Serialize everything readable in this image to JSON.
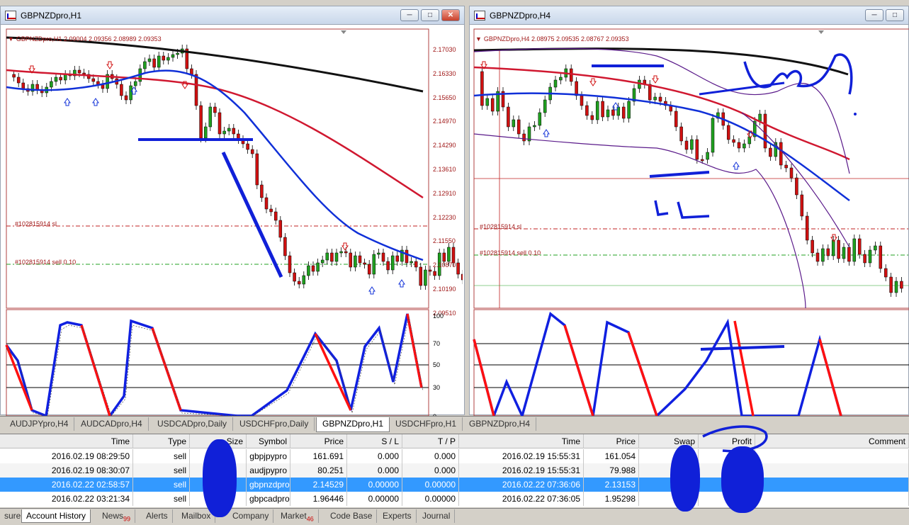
{
  "left_window": {
    "title": "GBPNZDpro,H1",
    "ohlc": "GBPNZDpro,H1  2.09004 2.09356 2.08989 2.09353",
    "sl_label": "#102815914 sl",
    "order_label": "#102815914 sell 0.10",
    "price_axis": [
      "2.17030",
      "2.16330",
      "2.15650",
      "2.14970",
      "2.14290",
      "2.13610",
      "2.12910",
      "2.12230",
      "2.11550",
      "2.10870",
      "2.10190",
      "2.09510"
    ],
    "osc_axis": [
      "100",
      "70",
      "50",
      "30",
      "0"
    ]
  },
  "right_window": {
    "title": "GBPNZDpro,H4",
    "ohlc": "GBPNZDpro,H4  2.08975 2.09535 2.08767 2.09353",
    "sl_label": "#102815914 sl",
    "order_label": "#102815914 sell 0.10"
  },
  "window_buttons": {
    "minimize": "─",
    "maximize": "□",
    "close": "✕"
  },
  "chart_tabs": [
    "AUDJPYpro,H4",
    "AUDCADpro,H4",
    "USDCADpro,Daily",
    "USDCHFpro,Daily",
    "GBPNZDpro,H1",
    "USDCHFpro,H1",
    "GBPNZDpro,H4"
  ],
  "active_chart_tab": "GBPNZDpro,H1",
  "table": {
    "headers": [
      "Time",
      "Type",
      "Size",
      "Symbol",
      "Price",
      "S / L",
      "T / P",
      "Time",
      "Price",
      "Swap",
      "Profit",
      "Comment"
    ],
    "rows": [
      [
        "2016.02.19 08:29:50",
        "sell",
        "",
        "gbpjpypro",
        "161.691",
        "0.000",
        "0.000",
        "2016.02.19 15:55:31",
        "161.054",
        "",
        ""
      ],
      [
        "2016.02.19 08:30:07",
        "sell",
        "",
        "audjpypro",
        "80.251",
        "0.000",
        "0.000",
        "2016.02.19 15:55:31",
        "79.988",
        "",
        ""
      ],
      [
        "2016.02.22 02:58:57",
        "sell",
        "",
        "gbpnzdpro",
        "2.14529",
        "0.00000",
        "0.00000",
        "2016.02.22 07:36:06",
        "2.13153",
        "",
        ""
      ],
      [
        "2016.02.22 03:21:34",
        "sell",
        "",
        "gbpcadpro",
        "1.96446",
        "0.00000",
        "0.00000",
        "2016.02.22 07:36:05",
        "1.95298",
        "",
        ""
      ]
    ]
  },
  "bottom_tabs": [
    {
      "label": "sure",
      "badge": ""
    },
    {
      "label": "Account History",
      "badge": ""
    },
    {
      "label": "News",
      "badge": "99"
    },
    {
      "label": "Alerts",
      "badge": ""
    },
    {
      "label": "Mailbox",
      "badge": ""
    },
    {
      "label": "Company",
      "badge": ""
    },
    {
      "label": "Market",
      "badge": "46"
    },
    {
      "label": "Code Base",
      "badge": ""
    },
    {
      "label": "Experts",
      "badge": ""
    },
    {
      "label": "Journal",
      "badge": ""
    }
  ],
  "colors": {
    "bull": "#1fa01f",
    "bear": "#d01010",
    "ma_slow": "#111111",
    "ma_mid": "#d01830",
    "ma_fast": "#1030d8",
    "osc_up": "#1020e0",
    "osc_down": "#ff1010",
    "annot": "#1020d8"
  }
}
